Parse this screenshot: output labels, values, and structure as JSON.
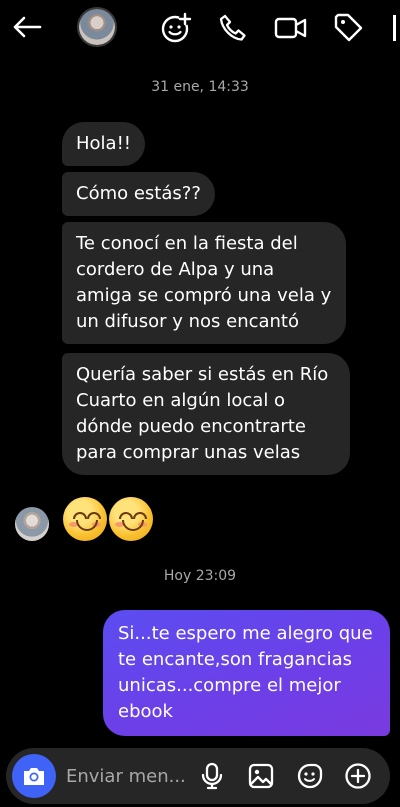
{
  "header": {
    "back_icon": "arrow-left-icon",
    "avatar": "profile-photo",
    "actions": [
      "add-emoji-icon",
      "phone-icon",
      "video-icon",
      "tag-icon"
    ]
  },
  "messages": {
    "timestamp_1": "31 ene, 14:33",
    "incoming": [
      "Hola!!",
      "Cómo estás??",
      "Te conocí en la fiesta del cordero de Alpa y una amiga se compró una vela y un difusor y nos encantó",
      "Quería saber si estás en Río Cuarto en algún local o dónde puedo encontrarte para comprar unas velas"
    ],
    "emoji": "😊😊",
    "timestamp_2": "Hoy 23:09",
    "outgoing": [
      "Si...te espero me alegro que te encante,son fragancias unicas...compre el mejor ebook"
    ]
  },
  "composer": {
    "placeholder": "Enviar men...",
    "value": "",
    "icons": [
      "camera-icon",
      "microphone-icon",
      "gallery-icon",
      "sticker-icon",
      "plus-icon"
    ]
  },
  "colors": {
    "background": "#000000",
    "incoming_bubble": "#262626",
    "outgoing_gradient_start": "#5b4df0",
    "outgoing_gradient_end": "#7a3ae0",
    "camera_button": "#3f63f6"
  }
}
